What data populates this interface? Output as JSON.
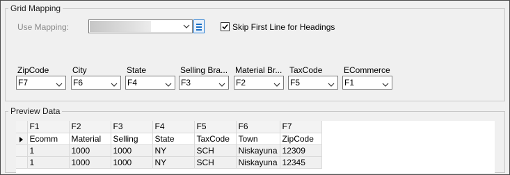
{
  "grid_mapping": {
    "title": "Grid Mapping",
    "use_mapping_label": "Use Mapping:",
    "use_mapping_value": "",
    "skip_first_line_label": "Skip First Line for Headings",
    "skip_first_line_checked": true,
    "fields": [
      {
        "label": "ZipCode",
        "value": "F7"
      },
      {
        "label": "City",
        "value": "F6"
      },
      {
        "label": "State",
        "value": "F4"
      },
      {
        "label": "Selling Bra...",
        "value": "F3"
      },
      {
        "label": "Material Br...",
        "value": "F2"
      },
      {
        "label": "TaxCode",
        "value": "F5"
      },
      {
        "label": "ECommerce",
        "value": "F1"
      }
    ]
  },
  "preview_data": {
    "title": "Preview Data",
    "columns": [
      "F1",
      "F2",
      "F3",
      "F4",
      "F5",
      "F6",
      "F7"
    ],
    "rows": [
      [
        "Ecomm",
        "Material",
        "Selling",
        "State",
        "TaxCode",
        "Town",
        "ZipCode"
      ],
      [
        "1",
        "1000",
        "1000",
        "NY",
        "SCH",
        "Niskayuna",
        "12309"
      ],
      [
        "1",
        "1000",
        "1000",
        "NY",
        "SCH",
        "Niskayuna",
        "12345"
      ]
    ]
  },
  "icons": {
    "dropdown": "chevron-down-icon",
    "list": "list-icon",
    "checkbox": "checkmark-icon",
    "current_row": "current-row-indicator-icon"
  },
  "colors": {
    "accent": "#1a6fc4",
    "window_bg": "#f0f0f0",
    "group_border": "#c8c8c8"
  }
}
